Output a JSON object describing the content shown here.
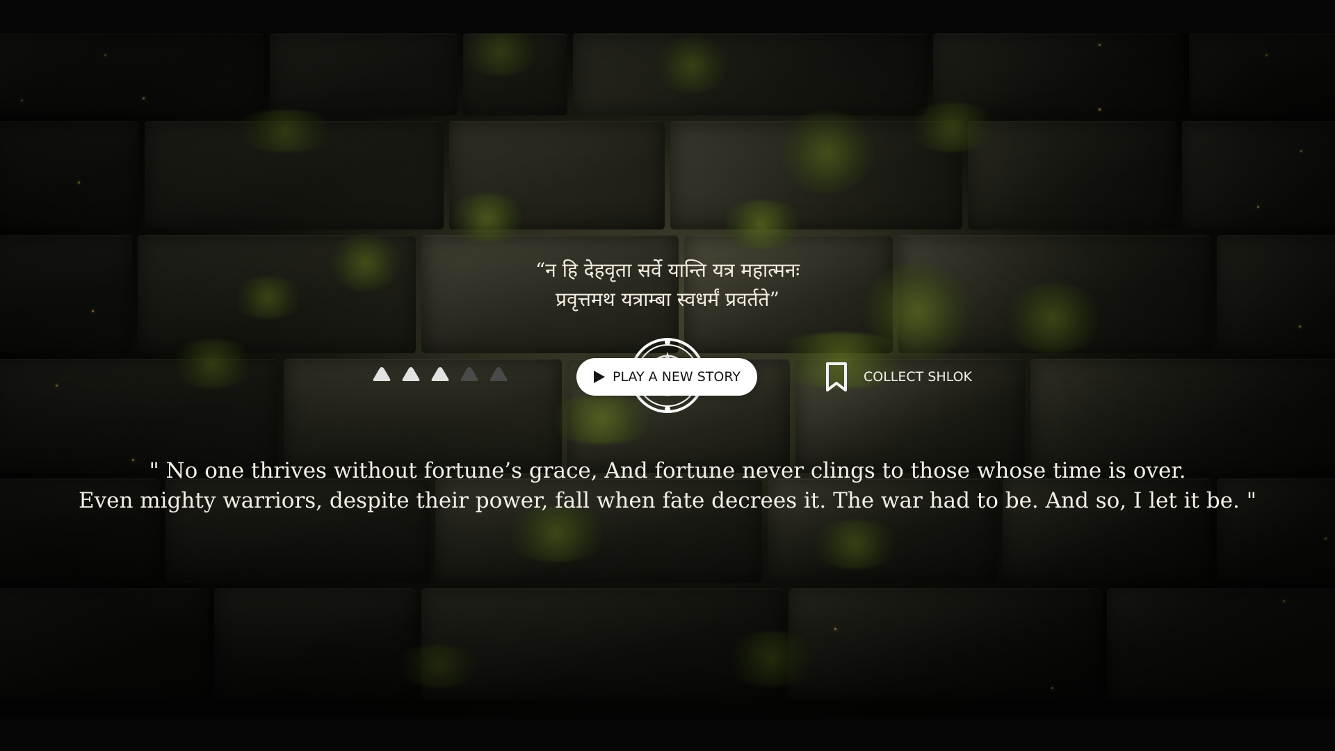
{
  "shlok": {
    "line1": "“न हि देहवृता सर्वे यान्ति यत्र महात्मनः",
    "line2": "प्रवृत्तमथ यत्राम्बा स्वधर्मं प्रवर्तते”"
  },
  "rating": {
    "value": 3,
    "max": 5,
    "icon": "triangle-icon",
    "filled_color": "#e2e2e2",
    "empty_color": "#4a4a4a"
  },
  "play_button": {
    "label": "PLAY A NEW STORY",
    "icon": "play-icon"
  },
  "collect": {
    "label": "COLLECT SHLOK",
    "icon": "bookmark-icon"
  },
  "translation": {
    "line1": "\" No one thrives without fortune’s grace, And fortune never clings to those whose time is over.",
    "line2": "Even mighty warriors, despite their power, fall when fate decrees it. The war had to be. And so, I let it be. \""
  },
  "colors": {
    "text": "#f3eee0",
    "button_bg": "#ffffff",
    "button_text": "#151515",
    "ember": "#f2c766"
  }
}
